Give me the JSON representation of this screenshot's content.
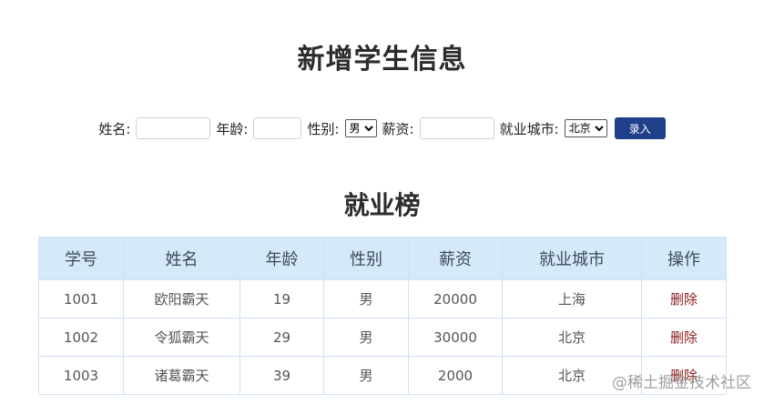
{
  "page": {
    "title": "新增学生信息",
    "subtitle": "就业榜",
    "watermark": "@稀土掘金技术社区"
  },
  "form": {
    "name_label": "姓名:",
    "name_value": "",
    "age_label": "年龄:",
    "age_value": "",
    "gender_label": "性别:",
    "gender_selected": "男",
    "salary_label": "薪资:",
    "salary_value": "",
    "city_label": "就业城市:",
    "city_selected": "北京",
    "submit_label": "录入"
  },
  "table": {
    "headers": [
      "学号",
      "姓名",
      "年龄",
      "性别",
      "薪资",
      "就业城市",
      "操作"
    ],
    "rows": [
      {
        "id": "1001",
        "name": "欧阳霸天",
        "age": "19",
        "gender": "男",
        "salary": "20000",
        "city": "上海",
        "action": "删除"
      },
      {
        "id": "1002",
        "name": "令狐霸天",
        "age": "29",
        "gender": "男",
        "salary": "30000",
        "city": "北京",
        "action": "删除"
      },
      {
        "id": "1003",
        "name": "诸葛霸天",
        "age": "39",
        "gender": "男",
        "salary": "2000",
        "city": "北京",
        "action": "删除"
      }
    ]
  },
  "colors": {
    "header_bg": "#d6e9fb",
    "border": "#cfe0f4",
    "button_bg": "#1f3f8b",
    "delete_link": "#8a1c1c"
  }
}
